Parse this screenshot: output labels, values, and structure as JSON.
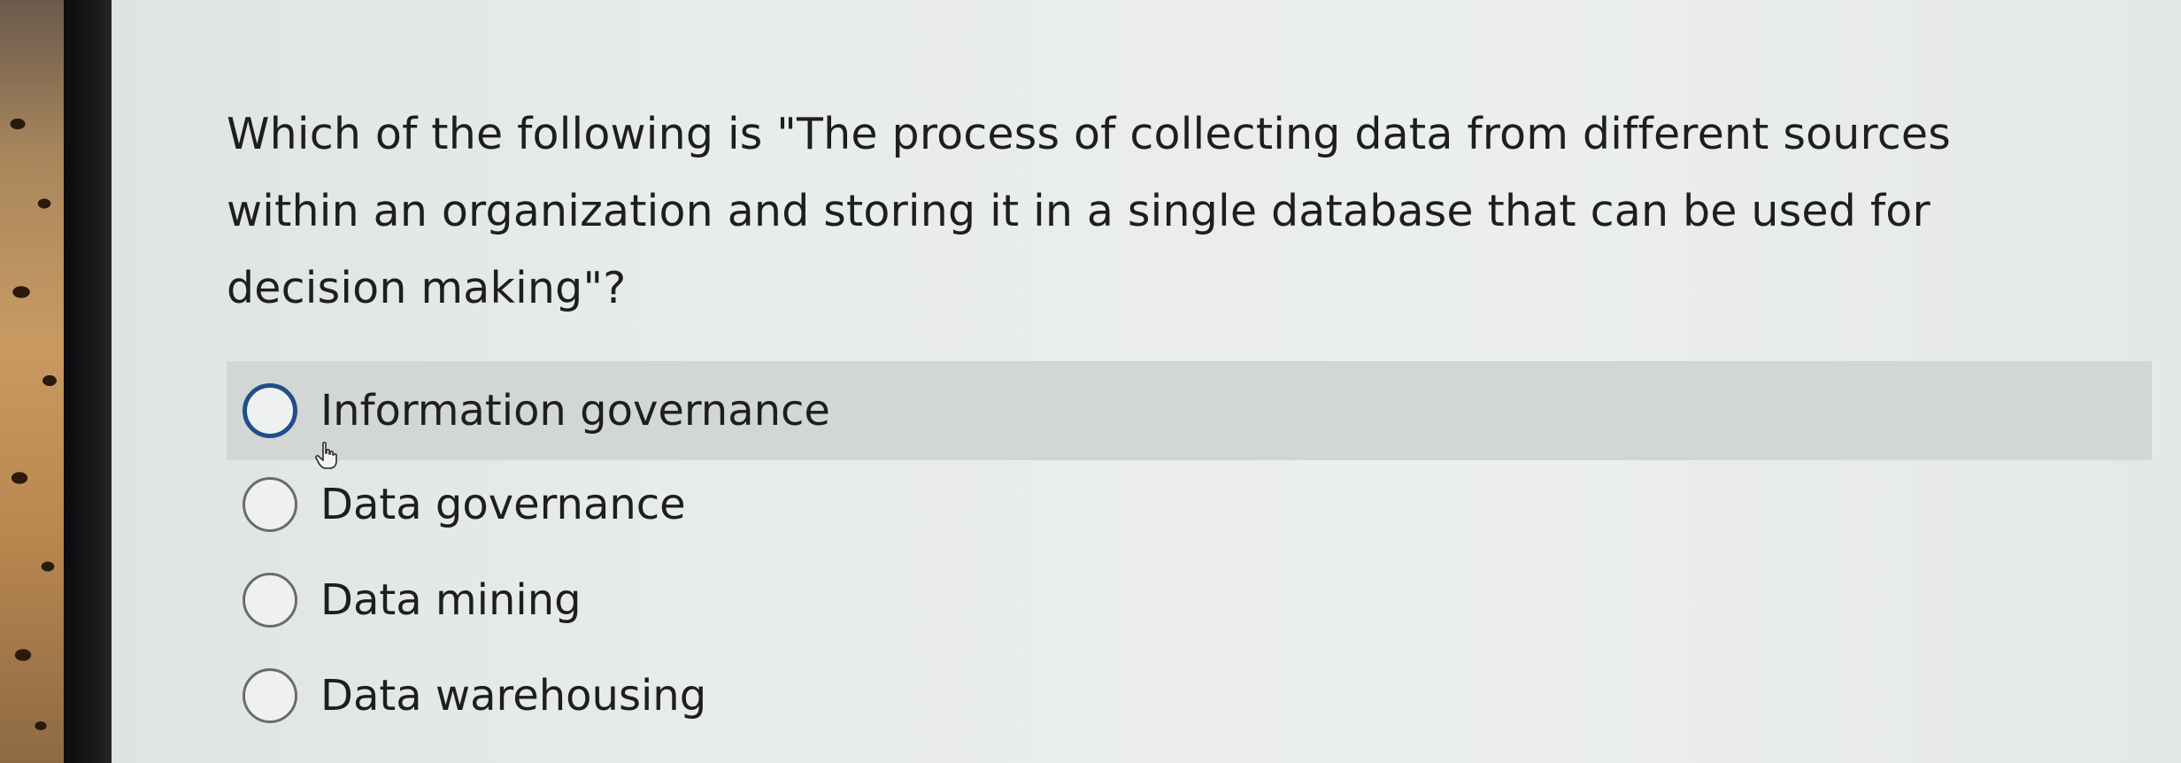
{
  "quiz": {
    "question": "Which of the following is \"The process of collecting data from different sources within an organization and storing it in a single database that can be used for decision making\"?",
    "options": [
      {
        "label": "Information governance",
        "hovered": true
      },
      {
        "label": "Data governance",
        "hovered": false
      },
      {
        "label": "Data mining",
        "hovered": false
      },
      {
        "label": "Data warehousing",
        "hovered": false
      }
    ]
  },
  "icons": {
    "cursor": "hand-pointer-icon"
  },
  "colors": {
    "hover_row": "#d2d6d5",
    "focus_ring": "#1f4f8a",
    "text": "#1e1e1e"
  }
}
